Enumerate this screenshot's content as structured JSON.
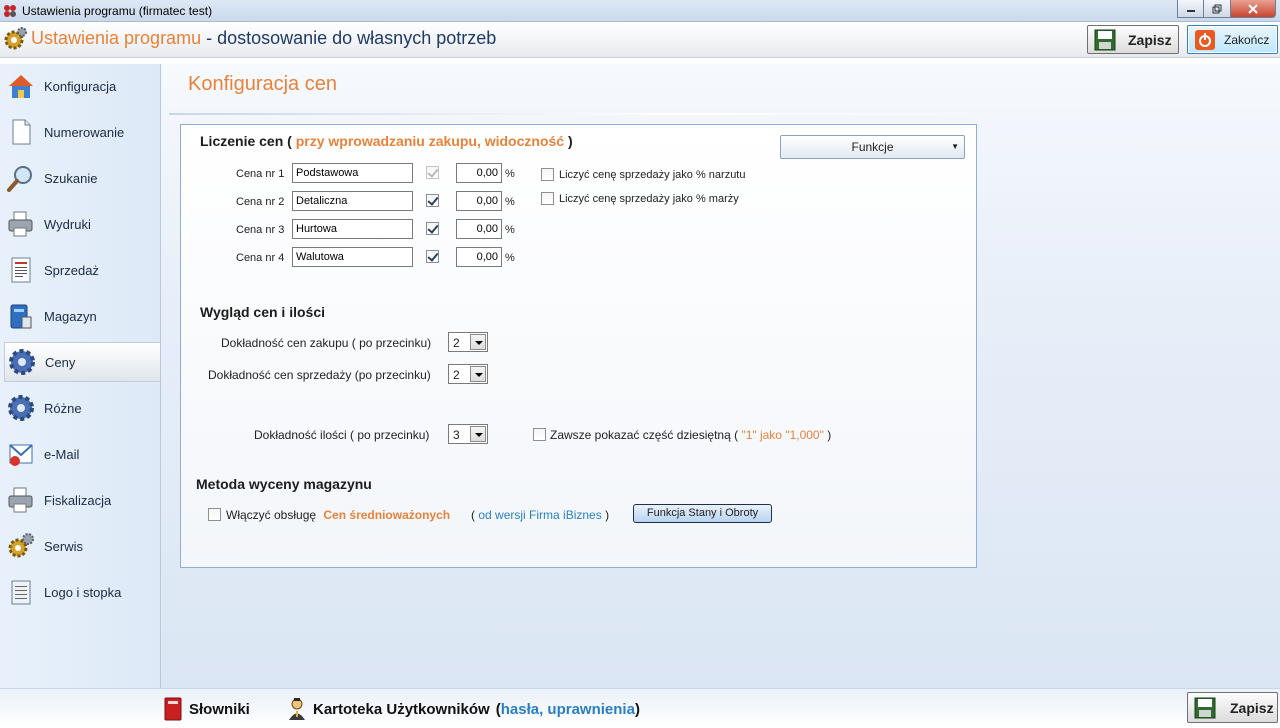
{
  "window": {
    "title": "Ustawienia programu (firmatec test)"
  },
  "header": {
    "title_part1": "Ustawienia programu",
    "title_sep": " - ",
    "title_part2": "dostosowanie do własnych potrzeb",
    "save_label": "Zapisz",
    "close_label": "Zakończ"
  },
  "sidebar": {
    "items": [
      {
        "label": "Konfiguracja",
        "icon": "house-icon"
      },
      {
        "label": "Numerowanie",
        "icon": "document-icon"
      },
      {
        "label": "Szukanie",
        "icon": "magnifier-icon"
      },
      {
        "label": "Wydruki",
        "icon": "printer-icon"
      },
      {
        "label": "Sprzedaż",
        "icon": "invoice-icon"
      },
      {
        "label": "Magazyn",
        "icon": "warehouse-icon"
      },
      {
        "label": "Ceny",
        "icon": "gear-icon"
      },
      {
        "label": "Różne",
        "icon": "gear-icon"
      },
      {
        "label": "e-Mail",
        "icon": "mail-icon"
      },
      {
        "label": "Fiskalizacja",
        "icon": "printer-icon"
      },
      {
        "label": "Serwis",
        "icon": "gears-icon"
      },
      {
        "label": "Logo i stopka",
        "icon": "notepad-icon"
      }
    ],
    "active_index": 6
  },
  "main": {
    "section_title": "Konfiguracja cen",
    "pricing": {
      "heading": "Liczenie cen (",
      "heading_accent": "przy wprowadzaniu zakupu, widoczność",
      "heading_close": ")",
      "functions_button": "Funkcje",
      "functions_arrow": "▼",
      "percent_sign": "%",
      "rows": [
        {
          "label": "Cena nr 1",
          "name": "Podstawowa",
          "checked": true,
          "disabled": true,
          "value": "0,00"
        },
        {
          "label": "Cena nr 2",
          "name": "Detaliczna",
          "checked": true,
          "disabled": false,
          "value": "0,00"
        },
        {
          "label": "Cena nr 3",
          "name": "Hurtowa",
          "checked": true,
          "disabled": false,
          "value": "0,00"
        },
        {
          "label": "Cena nr 4",
          "name": "Walutowa",
          "checked": true,
          "disabled": false,
          "value": "0,00"
        }
      ],
      "opt_markup": "Liczyć cenę sprzedaży jako % narzutu",
      "opt_margin": "Liczyć cenę sprzedaży jako % marży"
    },
    "appearance": {
      "heading": "Wygląd cen i ilości",
      "purchase_label": "Dokładność cen zakupu  ( po przecinku)",
      "purchase_value": "2",
      "sale_label": "Dokładność cen sprzedaży  (po przecinku)",
      "sale_value": "2",
      "qty_label": "Dokładność ilości  ( po przecinku)",
      "qty_value": "3",
      "decimal_label": "Zawsze pokazać część dziesiętną (",
      "decimal_example": "\"1\"  jako  \"1,000\"",
      "decimal_close": ")"
    },
    "valuation": {
      "heading": "Metoda wyceny magazynu",
      "enable_label": "Włączyć obsługę",
      "enable_accent": "Cen średnioważonych",
      "note_open": "(",
      "note_text": "od wersji Firma iBiznes",
      "note_close": ")",
      "button": "Funkcja Stany i Obroty"
    }
  },
  "footer": {
    "dictionaries": "Słowniki",
    "users_label": "Kartoteka Użytkowników",
    "users_paren_open": "(",
    "users_accent": "hasła, uprawnienia",
    "users_paren_close": ")",
    "save_label": "Zapisz"
  },
  "colors": {
    "accent": "#e8823a",
    "link_blue": "#2a7fc4",
    "panel_border": "#8fb0d6"
  }
}
